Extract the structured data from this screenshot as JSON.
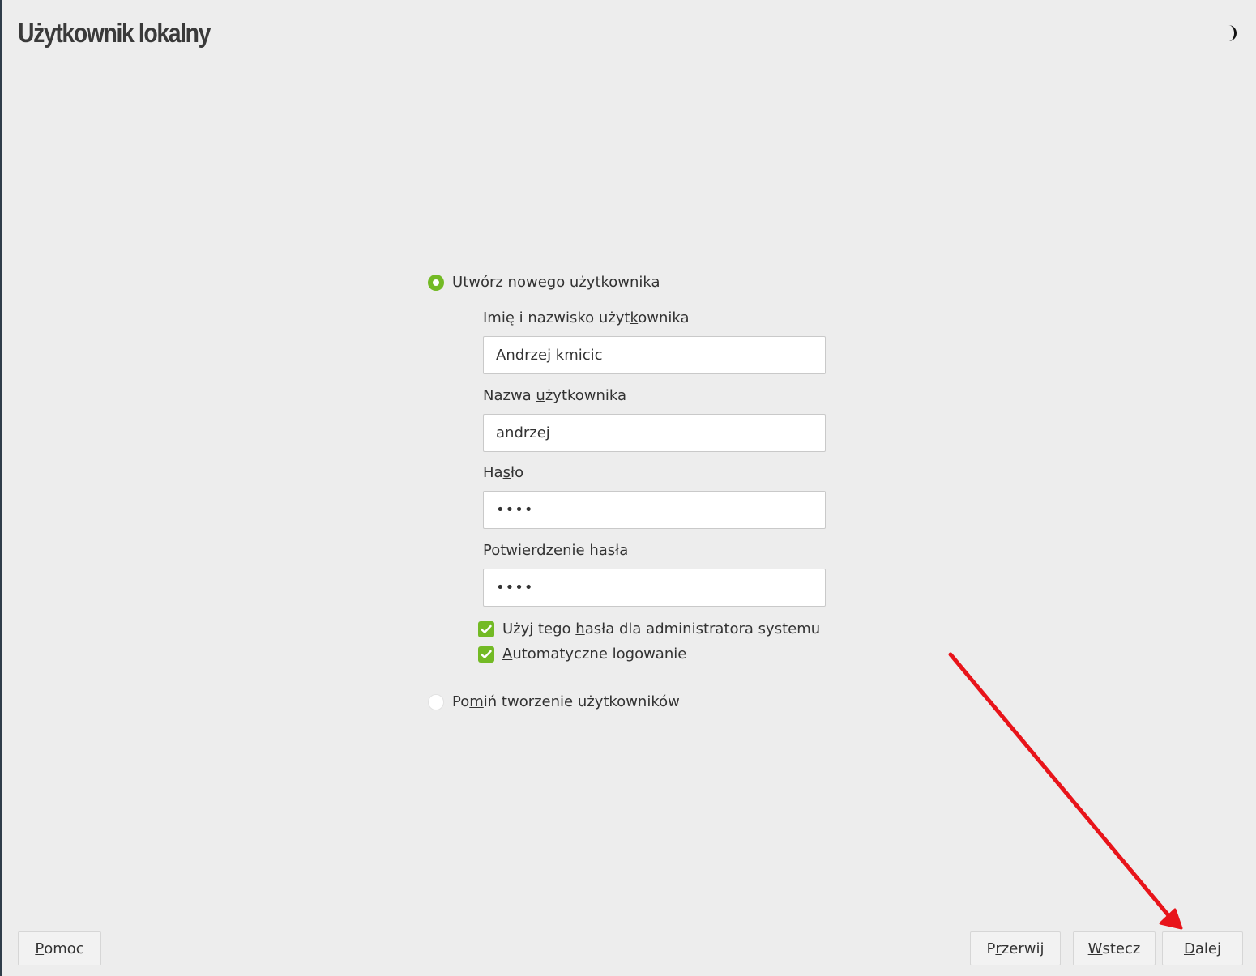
{
  "header": {
    "title": "Użytkownik lokalny",
    "theme_icon": "moon-icon"
  },
  "form": {
    "create_option": {
      "pre": "U",
      "accel": "t",
      "post": "wórz nowego użytkownika",
      "selected": true
    },
    "full_name": {
      "label_pre": "Imię i nazwisko użyt",
      "label_accel": "k",
      "label_post": "ownika",
      "value": "Andrzej kmicic"
    },
    "username": {
      "label_pre": "Nazwa ",
      "label_accel": "u",
      "label_post": "żytkownika",
      "value": "andrzej"
    },
    "password": {
      "label_pre": "Ha",
      "label_accel": "s",
      "label_post": "ło",
      "value": "••••"
    },
    "confirm_password": {
      "label_pre": "P",
      "label_accel": "o",
      "label_post": "twierdzenie hasła",
      "value": "••••"
    },
    "use_for_admin": {
      "pre": "Użyj tego ",
      "accel": "h",
      "post": "asła dla administratora systemu",
      "checked": true
    },
    "auto_login": {
      "pre": "",
      "accel": "A",
      "post": "utomatyczne logowanie",
      "checked": true
    },
    "skip_option": {
      "pre": "Po",
      "accel": "m",
      "post": "iń tworzenie użytkowników",
      "selected": false
    }
  },
  "footer": {
    "help": {
      "accel": "P",
      "post": "omoc"
    },
    "abort": {
      "pre": "P",
      "accel": "r",
      "post": "zerwij"
    },
    "back": {
      "accel": "W",
      "post": "stecz"
    },
    "next": {
      "accel": "D",
      "post": "alej"
    }
  },
  "colors": {
    "accent": "#73ba25",
    "annotation_arrow": "#e8141a",
    "background": "#ededed"
  }
}
